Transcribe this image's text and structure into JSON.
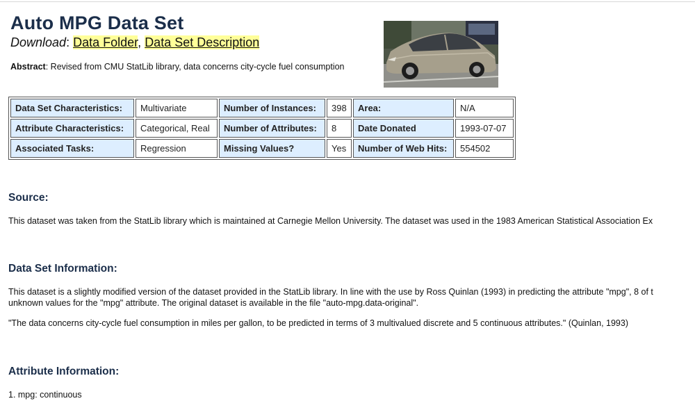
{
  "dataset": {
    "title": "Auto MPG Data Set",
    "download_label": "Download",
    "download_colon": ":",
    "link_data_folder": "Data Folder",
    "link_separator": ",",
    "link_description": "Data Set Description",
    "abstract_label": "Abstract",
    "abstract_text": ": Revised from CMU StatLib library, data concerns city-cycle fuel consumption"
  },
  "characteristics": [
    [
      {
        "label": "Data Set Characteristics:",
        "value": "Multivariate"
      },
      {
        "label": "Number of Instances:",
        "value": "398"
      },
      {
        "label": "Area:",
        "value": "N/A"
      }
    ],
    [
      {
        "label": "Attribute Characteristics:",
        "value": "Categorical, Real"
      },
      {
        "label": "Number of Attributes:",
        "value": "8"
      },
      {
        "label": "Date Donated",
        "value": "1993-07-07"
      }
    ],
    [
      {
        "label": "Associated Tasks:",
        "value": "Regression"
      },
      {
        "label": "Missing Values?",
        "value": "Yes"
      },
      {
        "label": "Number of Web Hits:",
        "value": "554502"
      }
    ]
  ],
  "source": {
    "heading": "Source:",
    "text": "This dataset was taken from the StatLib library which is maintained at Carnegie Mellon University. The dataset was used in the 1983 American Statistical Association Ex"
  },
  "info": {
    "heading": "Data Set Information:",
    "line1": "This dataset is a slightly modified version of the dataset provided in the StatLib library. In line with the use by Ross Quinlan (1993) in predicting the attribute \"mpg\", 8 of t",
    "line2": "unknown values for the \"mpg\" attribute. The original dataset is available in the file \"auto-mpg.data-original\".",
    "quote": "\"The data concerns city-cycle fuel consumption in miles per gallon, to be predicted in terms of 3 multivalued discrete and 5 continuous attributes.\" (Quinlan, 1993)"
  },
  "attributes": {
    "heading": "Attribute Information:",
    "item1": "1. mpg: continuous"
  },
  "colors": {
    "heading": "#1b2e4a",
    "label_cell_bg": "#ddeeff",
    "link_highlight": "#ffff99"
  },
  "icons": {
    "dataset_image": "car-photo"
  }
}
